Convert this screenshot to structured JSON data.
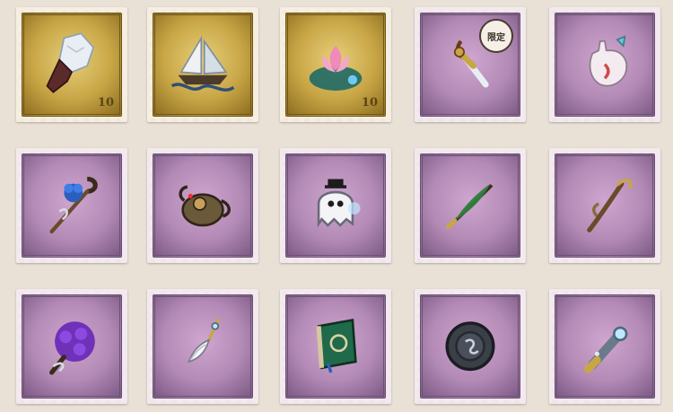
{
  "items": [
    {
      "name": "crystal-shard-icon",
      "rarity": "gold",
      "value_tag": "10"
    },
    {
      "name": "sailing-ship-icon",
      "rarity": "gold",
      "value_tag": ""
    },
    {
      "name": "lotus-flower-icon",
      "rarity": "gold",
      "value_tag": "10"
    },
    {
      "name": "golden-sword-icon",
      "rarity": "purple",
      "value_tag": "",
      "badge": "限定"
    },
    {
      "name": "bottle-fish-icon",
      "rarity": "purple",
      "value_tag": ""
    },
    {
      "name": "blue-rose-cane-icon",
      "rarity": "purple",
      "value_tag": ""
    },
    {
      "name": "mechanical-device-icon",
      "rarity": "purple",
      "value_tag": ""
    },
    {
      "name": "ghost-doll-icon",
      "rarity": "purple",
      "value_tag": ""
    },
    {
      "name": "feather-quill-icon",
      "rarity": "purple",
      "value_tag": ""
    },
    {
      "name": "branch-staff-icon",
      "rarity": "purple",
      "value_tag": ""
    },
    {
      "name": "purple-bouquet-icon",
      "rarity": "purple",
      "value_tag": ""
    },
    {
      "name": "feather-pendant-icon",
      "rarity": "purple",
      "value_tag": ""
    },
    {
      "name": "green-book-icon",
      "rarity": "purple",
      "value_tag": ""
    },
    {
      "name": "round-shield-icon",
      "rarity": "purple",
      "value_tag": ""
    },
    {
      "name": "scroll-telescope-icon",
      "rarity": "purple",
      "value_tag": ""
    }
  ],
  "colors": {
    "gold": "#c8a646",
    "purple": "#b28ab5",
    "background": "#e9e0d6"
  }
}
